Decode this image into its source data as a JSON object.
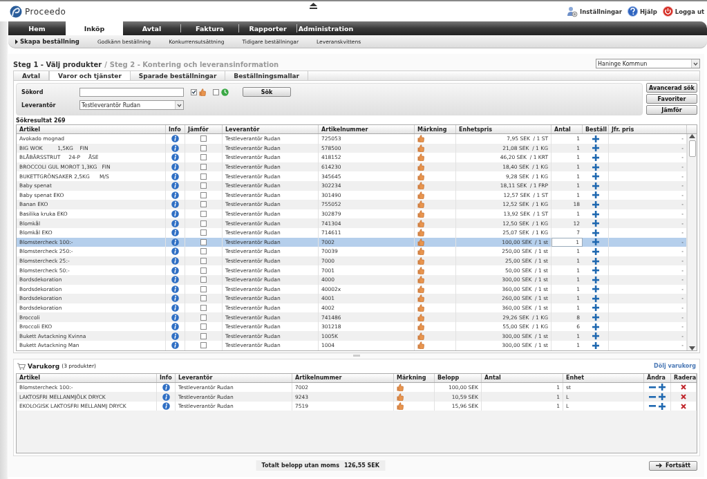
{
  "app": {
    "name": "Proceedo"
  },
  "top_links": [
    {
      "kind": "settings",
      "label": "Inställningar"
    },
    {
      "kind": "help",
      "label": "Hjälp"
    },
    {
      "kind": "logout",
      "label": "Logga ut"
    }
  ],
  "nav": [
    {
      "label": "Hem",
      "selected": false
    },
    {
      "label": "Inköp",
      "selected": true
    },
    {
      "label": "Avtal",
      "selected": false
    },
    {
      "label": "Faktura",
      "selected": false
    },
    {
      "label": "Rapporter",
      "selected": false
    },
    {
      "label": "Administration",
      "selected": false
    }
  ],
  "subnav": [
    {
      "label": "Skapa beställning",
      "selected": true
    },
    {
      "label": "Godkänn beställning",
      "selected": false
    },
    {
      "label": "Konkurrensutsättning",
      "selected": false
    },
    {
      "label": "Tidigare beställningar",
      "selected": false
    },
    {
      "label": "Leveranskvittens",
      "selected": false
    }
  ],
  "steps": [
    {
      "label": "Steg 1 - Välj produkter",
      "active": true
    },
    {
      "label": "Steg 2 - Kontering och leveransinformation",
      "active": false
    }
  ],
  "step_separator": "/",
  "organization": {
    "value": "Haninge Kommun"
  },
  "tabs": [
    {
      "label": "Avtal",
      "selected": false
    },
    {
      "label": "Varor och tjänster",
      "selected": true
    },
    {
      "label": "Sparade beställningar",
      "selected": false
    },
    {
      "label": "Beställningsmallar",
      "selected": false
    }
  ],
  "search": {
    "keyword_label": "Sökord",
    "thumb_filter": {
      "checked": true
    },
    "clock_filter": {
      "checked": false
    },
    "search_button": "Sök",
    "supplier_label": "Leverantör",
    "supplier_value": "Testleverantör Rudan"
  },
  "side_buttons": [
    "Avancerad sök",
    "Favoriter",
    "Jämför"
  ],
  "result_count": "Sökresultat 269",
  "results": {
    "columns": [
      "Artikel",
      "Info",
      "Jämför",
      "Leverantör",
      "Artikelnummer",
      "Märkning",
      "Enhetspris",
      "Antal",
      "Beställ",
      "Jfr. pris"
    ],
    "rows": [
      {
        "artikel": "Avokado mognad",
        "leverantor": "Testleverantör Rudan",
        "nr": "725053",
        "pris": "7,95 SEK  / 1 ST",
        "antal": "1",
        "jfr": "-",
        "compare": false,
        "selected": false
      },
      {
        "artikel": "BIG WOK         1,5KG    FIN",
        "leverantor": "Testleverantör Rudan",
        "nr": "578500",
        "pris": "21,08 SEK  / 1 KG",
        "antal": "1",
        "jfr": "-",
        "compare": false,
        "selected": false
      },
      {
        "artikel": "BLÅBÄRSSTRUT     24-P     ÅSE",
        "leverantor": "Testleverantör Rudan",
        "nr": "418152",
        "pris": "46,20 SEK  / 1 KRT",
        "antal": "1",
        "jfr": "-",
        "compare": false,
        "selected": false
      },
      {
        "artikel": "BROCCOLI GUL MOROT 1,3KG   FIN",
        "leverantor": "Testleverantör Rudan",
        "nr": "614230",
        "pris": "18,40 SEK  / 1 KG",
        "antal": "1",
        "jfr": "-",
        "compare": false,
        "selected": false
      },
      {
        "artikel": "BUKETTGRÖNSAKER 2,5KG      M/S",
        "leverantor": "Testleverantör Rudan",
        "nr": "345645",
        "pris": "9,28 SEK  / 1 KG",
        "antal": "1",
        "jfr": "-",
        "compare": false,
        "selected": false
      },
      {
        "artikel": "Baby spenat",
        "leverantor": "Testleverantör Rudan",
        "nr": "302234",
        "pris": "18,11 SEK  / 1 FRP",
        "antal": "1",
        "jfr": "-",
        "compare": false,
        "selected": false
      },
      {
        "artikel": "Baby spenat EKO",
        "leverantor": "Testleverantör Rudan",
        "nr": "301490",
        "pris": "12,57 SEK  / 1 ST",
        "antal": "1",
        "jfr": "-",
        "compare": false,
        "selected": false
      },
      {
        "artikel": "Banan EKO",
        "leverantor": "Testleverantör Rudan",
        "nr": "755052",
        "pris": "12,52 SEK  / 1 KG",
        "antal": "18",
        "jfr": "-",
        "compare": false,
        "selected": false
      },
      {
        "artikel": "Basilika kruka EKO",
        "leverantor": "Testleverantör Rudan",
        "nr": "302879",
        "pris": "13,92 SEK  / 1 ST",
        "antal": "1",
        "jfr": "-",
        "compare": false,
        "selected": false
      },
      {
        "artikel": "Blomkål",
        "leverantor": "Testleverantör Rudan",
        "nr": "741304",
        "pris": "12,50 SEK  / 1 KG",
        "antal": "12",
        "jfr": "-",
        "compare": false,
        "selected": false
      },
      {
        "artikel": "Blomkål EKO",
        "leverantor": "Testleverantör Rudan",
        "nr": "714611",
        "pris": "25,07 SEK  / 1 KG",
        "antal": "7",
        "jfr": "-",
        "compare": false,
        "selected": false
      },
      {
        "artikel": "Blomstercheck 100:-",
        "leverantor": "Testleverantör Rudan",
        "nr": "7002",
        "pris": "100,00 SEK  / 1 st",
        "antal": "1",
        "jfr": "-",
        "compare": false,
        "selected": true
      },
      {
        "artikel": "Blomstercheck 250:-",
        "leverantor": "Testleverantör Rudan",
        "nr": "70039",
        "pris": "250,00 SEK  / 1 st",
        "antal": "1",
        "jfr": "-",
        "compare": false,
        "selected": false
      },
      {
        "artikel": "Blomstercheck 25:-",
        "leverantor": "Testleverantör Rudan",
        "nr": "7000",
        "pris": "25,00 SEK  / 1 st",
        "antal": "1",
        "jfr": "-",
        "compare": false,
        "selected": false
      },
      {
        "artikel": "Blomstercheck 50:-",
        "leverantor": "Testleverantör Rudan",
        "nr": "7001",
        "pris": "50,00 SEK  / 1 st",
        "antal": "1",
        "jfr": "-",
        "compare": false,
        "selected": false
      },
      {
        "artikel": "Bordsdekoration",
        "leverantor": "Testleverantör Rudan",
        "nr": "4000",
        "pris": "300,00 SEK  / 1 st",
        "antal": "1",
        "jfr": "-",
        "compare": false,
        "selected": false
      },
      {
        "artikel": "Bordsdekoration",
        "leverantor": "Testleverantör Rudan",
        "nr": "40002x",
        "pris": "360,00 SEK  / 1 st",
        "antal": "1",
        "jfr": "-",
        "compare": false,
        "selected": false
      },
      {
        "artikel": "Bordsdekoration",
        "leverantor": "Testleverantör Rudan",
        "nr": "4001",
        "pris": "260,00 SEK  / 1 st",
        "antal": "1",
        "jfr": "-",
        "compare": false,
        "selected": false
      },
      {
        "artikel": "Bordsdekoration",
        "leverantor": "Testleverantör Rudan",
        "nr": "4002",
        "pris": "360,00 SEK  / 1 st",
        "antal": "1",
        "jfr": "-",
        "compare": false,
        "selected": false
      },
      {
        "artikel": "Broccoli",
        "leverantor": "Testleverantör Rudan",
        "nr": "741486",
        "pris": "29,26 SEK  / 1 KG",
        "antal": "8",
        "jfr": "-",
        "compare": false,
        "selected": false
      },
      {
        "artikel": "Broccoli EKO",
        "leverantor": "Testleverantör Rudan",
        "nr": "301218",
        "pris": "55,00 SEK  / 1 KG",
        "antal": "6",
        "jfr": "-",
        "compare": false,
        "selected": false
      },
      {
        "artikel": "Bukett Avtackning Kvinna",
        "leverantor": "Testleverantör Rudan",
        "nr": "1005K",
        "pris": "300,00 SEK  / 1 st",
        "antal": "1",
        "jfr": "-",
        "compare": false,
        "selected": false
      },
      {
        "artikel": "Bukett Avtackning Man",
        "leverantor": "Testleverantör Rudan",
        "nr": "1004",
        "pris": "300,00 SEK  / 1 st",
        "antal": "1",
        "jfr": "-",
        "compare": false,
        "selected": false
      }
    ]
  },
  "cart": {
    "title": "Varukorg",
    "count": "(3 produkter)",
    "hide_link": "Dölj varukorg",
    "columns": [
      "Artikel",
      "Info",
      "Leverantör",
      "Artikelnummer",
      "Märkning",
      "Belopp",
      "Antal",
      "Enhet",
      "Ändra",
      "Radera"
    ],
    "rows": [
      {
        "artikel": "Blomstercheck 100:-",
        "leverantor": "Testleverantör Rudan",
        "nr": "7002",
        "belopp": "100,00 SEK",
        "antal": "1",
        "enhet": "st"
      },
      {
        "artikel": "LAKTOSFRI MELLANMJÖLK DRYCK",
        "leverantor": "Testleverantör Rudan",
        "nr": "9243",
        "belopp": "10,59 SEK",
        "antal": "1",
        "enhet": "L"
      },
      {
        "artikel": "EKOLOGISK LAKTOSFRI MELLANMJ DRYCK",
        "leverantor": "Testleverantör Rudan",
        "nr": "7519",
        "belopp": "15,96 SEK",
        "antal": "1",
        "enhet": "L"
      }
    ]
  },
  "total": {
    "label": "Totalt belopp utan moms",
    "value": "126,55 SEK"
  },
  "continue_button": "Fortsätt"
}
